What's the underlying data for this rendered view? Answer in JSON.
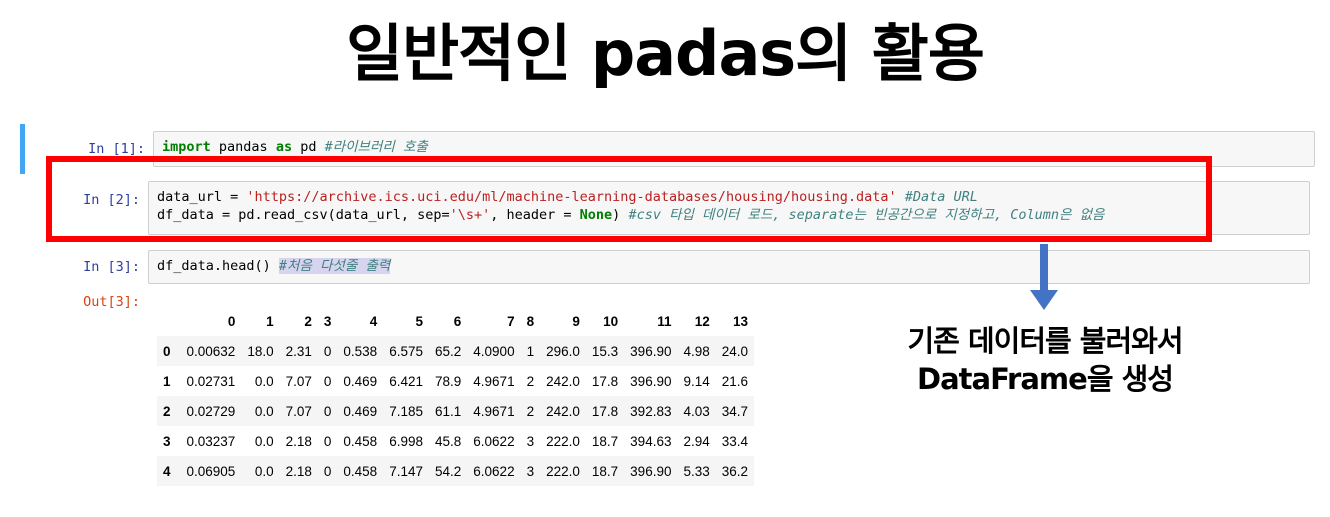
{
  "title": "일반적인 padas의 활용",
  "cells": {
    "c1": {
      "prompt": "In [1]:",
      "code": {
        "kw": "import",
        "p1": " pandas ",
        "kw2": "as",
        "p2": " pd ",
        "comment": "#라이브러리 호출"
      }
    },
    "c2": {
      "prompt": "In [2]:",
      "line1": {
        "a": "data_url = ",
        "str": "'https://archive.ics.uci.edu/ml/machine-learning-databases/housing/housing.data'",
        "b": " ",
        "comment": "#Data URL"
      },
      "line2": {
        "a": "df_data = pd.read_csv(data_url, sep=",
        "str": "'\\s+'",
        "b": ", header = ",
        "kw": "None",
        "c": ") ",
        "comment": "#csv 타입 데이터 로드, separate는 빈공간으로 지정하고, Column은 없음"
      }
    },
    "c3": {
      "prompt": "In [3]:",
      "code": {
        "a": "df_data.head() ",
        "comment": "#처음 다섯줄 출력"
      }
    },
    "out3": {
      "prompt": "Out[3]:"
    }
  },
  "table": {
    "columns": [
      "0",
      "1",
      "2",
      "3",
      "4",
      "5",
      "6",
      "7",
      "8",
      "9",
      "10",
      "11",
      "12",
      "13"
    ],
    "rows": [
      {
        "index": "0",
        "values": [
          "0.00632",
          "18.0",
          "2.31",
          "0",
          "0.538",
          "6.575",
          "65.2",
          "4.0900",
          "1",
          "296.0",
          "15.3",
          "396.90",
          "4.98",
          "24.0"
        ]
      },
      {
        "index": "1",
        "values": [
          "0.02731",
          "0.0",
          "7.07",
          "0",
          "0.469",
          "6.421",
          "78.9",
          "4.9671",
          "2",
          "242.0",
          "17.8",
          "396.90",
          "9.14",
          "21.6"
        ]
      },
      {
        "index": "2",
        "values": [
          "0.02729",
          "0.0",
          "7.07",
          "0",
          "0.469",
          "7.185",
          "61.1",
          "4.9671",
          "2",
          "242.0",
          "17.8",
          "392.83",
          "4.03",
          "34.7"
        ]
      },
      {
        "index": "3",
        "values": [
          "0.03237",
          "0.0",
          "2.18",
          "0",
          "0.458",
          "6.998",
          "45.8",
          "6.0622",
          "3",
          "222.0",
          "18.7",
          "394.63",
          "2.94",
          "33.4"
        ]
      },
      {
        "index": "4",
        "values": [
          "0.06905",
          "0.0",
          "2.18",
          "0",
          "0.458",
          "7.147",
          "54.2",
          "6.0622",
          "3",
          "222.0",
          "18.7",
          "396.90",
          "5.33",
          "36.2"
        ]
      }
    ]
  },
  "annotation": {
    "line1": "기존 데이터를 불러와서",
    "line2": "DataFrame을 생성"
  },
  "colors": {
    "highlight_box": "#ff0000",
    "arrow": "#4472c4",
    "selected_cell": "#42a5f5"
  }
}
